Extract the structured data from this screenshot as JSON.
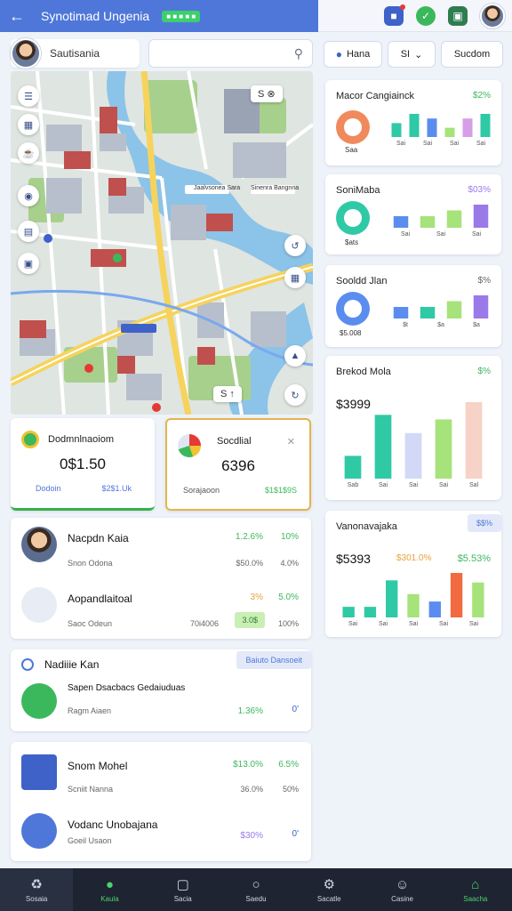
{
  "header": {
    "title": "Synotimad Ungenia",
    "badge": "■ ■ ■ ■ ■",
    "back_icon": "arrow-left-icon",
    "colors": {
      "primary": "#4f77d9",
      "accent": "#3cb85c"
    }
  },
  "user": {
    "name": "Sautisania"
  },
  "search": {
    "placeholder": "",
    "value": ""
  },
  "filters": {
    "location": "Hana",
    "select": "SI",
    "sort": "Sucdom"
  },
  "map": {
    "labels": [
      "Jaalvsonea Sara",
      "Sinenra Bangnna"
    ],
    "top_controls": "S  ⊗",
    "bottom_controls": "S  ↑"
  },
  "stats": [
    {
      "title": "Dodmnlnaoiom",
      "value": "0$1.50",
      "foot_left": "Dodoin",
      "foot_right": "$2$1.Uk"
    },
    {
      "title": "Socdlial",
      "value": "6396",
      "foot_left": "Sorajaoon",
      "foot_right": "$1$1$9S"
    }
  ],
  "people": [
    {
      "name": "Nacpdn Kaia",
      "sub": "Snon Odona",
      "v1": "1.2.6%",
      "v2": "10%",
      "s1": "$50.0%",
      "s2": "4.0%"
    },
    {
      "name": "Aopandlaitoal",
      "sub": "Saoc Odeun",
      "v1": "3%",
      "v2": "5.0%",
      "tag": "3.0$",
      "s1": "70i4006",
      "s2": "100%"
    }
  ],
  "section": {
    "title": "Nadiiie Kan",
    "tag": "Baiuto Dansoeit",
    "row": {
      "name": "Sapen Dsacbacs Gedaiuduas",
      "sub": "Ragm Aiaen",
      "v1": "1.36%",
      "v2": "0'"
    }
  },
  "products": [
    {
      "name": "Snom Mohel",
      "sub": "Scniit Nanna",
      "v1": "$13.0%",
      "v2": "6.5%",
      "s1": "36.0%",
      "s2": "50%"
    },
    {
      "name": "Vodanc Unobajana",
      "sub": "Goeil Usaon",
      "v1": "$30%",
      "v2": "0'"
    }
  ],
  "charts": [
    {
      "title": "Macor Cangiainck",
      "pct": "$2%",
      "sublabel": "Saa",
      "chart_data": {
        "type": "bar",
        "categories": [
          "Sai",
          "Sai",
          "Sai",
          "Sai"
        ],
        "values": [
          3,
          5,
          4,
          2,
          4,
          5
        ],
        "colors": [
          "#2fc9a6",
          "#2fc9a6",
          "#5b8def",
          "#a6e37a",
          "#d79ee8",
          "#2fc9a6"
        ]
      }
    },
    {
      "title": "SoniMaba",
      "pct": "$03%",
      "sublabel": "$ats",
      "chart_data": {
        "type": "bar",
        "categories": [
          "Sai",
          "Sai",
          "Sai"
        ],
        "values": [
          2,
          2,
          3,
          4
        ],
        "colors": [
          "#5b8def",
          "#a6e37a",
          "#a6e37a",
          "#9a7ae8"
        ]
      }
    },
    {
      "title": "Sooldd Jlan",
      "pct": "$%",
      "sublabel": "$5.008",
      "chart_data": {
        "type": "bar",
        "categories": [
          "$t",
          "$a",
          "$a"
        ],
        "values": [
          2,
          2,
          3,
          4
        ],
        "colors": [
          "#5b8def",
          "#2fc9a6",
          "#a6e37a",
          "#9a7ae8"
        ]
      }
    },
    {
      "title": "Brekod Mola",
      "pct": "$%",
      "big": "$3999",
      "chart_data": {
        "type": "bar",
        "categories": [
          "Sab",
          "Sai",
          "Sai",
          "Sai",
          "Sal"
        ],
        "values": [
          25,
          70,
          50,
          65,
          84
        ],
        "colors": [
          "#2fc9a6",
          "#2fc9a6",
          "#d4d8f7",
          "#a6e37a",
          "#f7d2c7"
        ]
      }
    },
    {
      "title": "Vanonavajaka",
      "pct": "$$%",
      "big": "$5393",
      "mid": "$301.0%",
      "right": "$5.53%",
      "chart_data": {
        "type": "bar",
        "categories": [
          "Sai",
          "Sai",
          "Sai",
          "Sai",
          "Sai"
        ],
        "values": [
          10,
          10,
          35,
          22,
          15,
          42,
          33
        ],
        "colors": [
          "#2fc9a6",
          "#2fc9a6",
          "#2fc9a6",
          "#a6e37a",
          "#5b8def",
          "#f26a3f",
          "#a6e37a"
        ]
      }
    }
  ],
  "nav": [
    {
      "label": "Sosaia",
      "icon": "recycle-icon"
    },
    {
      "label": "Kaula",
      "icon": "pin-icon"
    },
    {
      "label": "Sacia",
      "icon": "square-icon"
    },
    {
      "label": "Saedu",
      "icon": "circle-icon"
    },
    {
      "label": "Sacatle",
      "icon": "gear-icon"
    },
    {
      "label": "Casine",
      "icon": "smile-icon"
    },
    {
      "label": "Saacha",
      "icon": "home-icon"
    }
  ]
}
